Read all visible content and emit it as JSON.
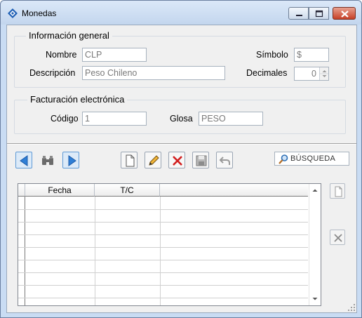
{
  "window": {
    "title": "Monedas",
    "accent_color": "#c9dcf3",
    "close_color": "#c64027"
  },
  "general": {
    "title": "Información general",
    "nombre_label": "Nombre",
    "nombre_value": "CLP",
    "descripcion_label": "Descripción",
    "descripcion_value": "Peso Chileno",
    "simbolo_label": "Símbolo",
    "simbolo_value": "$",
    "decimales_label": "Decimales",
    "decimales_value": "0"
  },
  "facturacion": {
    "title": "Facturación electrónica",
    "codigo_label": "Código",
    "codigo_value": "1",
    "glosa_label": "Glosa",
    "glosa_value": "PESO"
  },
  "toolbar": {
    "icons": [
      "prev-arrow-icon",
      "binoculars-icon",
      "next-arrow-icon",
      "new-document-icon",
      "pencil-edit-icon",
      "delete-x-icon",
      "save-disk-icon",
      "undo-icon"
    ],
    "search_label": "BÚSQUEDA"
  },
  "grid": {
    "columns": [
      "Fecha",
      "T/C"
    ],
    "rows": []
  },
  "side": {
    "icons": [
      "new-row-icon",
      "delete-row-icon"
    ]
  }
}
